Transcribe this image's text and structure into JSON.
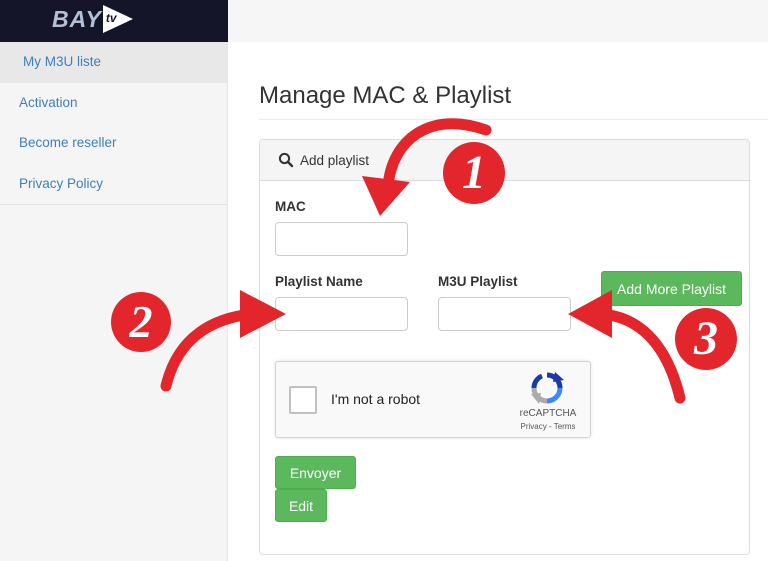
{
  "brand": {
    "name": "BAY",
    "suffix": "tv"
  },
  "sidebar": {
    "items": [
      {
        "label": "My M3U liste",
        "active": true
      },
      {
        "label": "Activation",
        "active": false
      },
      {
        "label": "Become reseller",
        "active": false
      },
      {
        "label": "Privacy Policy",
        "active": false
      }
    ]
  },
  "page": {
    "title": "Manage MAC & Playlist"
  },
  "panel": {
    "header": "Add playlist",
    "header_icon": "search-icon",
    "mac_label": "MAC",
    "mac_value": "",
    "playlist_name_label": "Playlist Name",
    "playlist_name_value": "",
    "m3u_playlist_label": "M3U Playlist",
    "m3u_playlist_value": "",
    "add_more_label": "Add More Playlist",
    "submit_label": "Envoyer",
    "edit_label": "Edit"
  },
  "captcha": {
    "label": "I'm not a robot",
    "brand": "reCAPTCHA",
    "links": "Privacy - Terms"
  },
  "annotations": [
    {
      "number": "1"
    },
    {
      "number": "2"
    },
    {
      "number": "3"
    }
  ],
  "colors": {
    "sidebar_link": "#3f7fbd",
    "button_green": "#5cb85c",
    "annotation_red": "#e3262c",
    "logo_bar": "#15152a"
  }
}
